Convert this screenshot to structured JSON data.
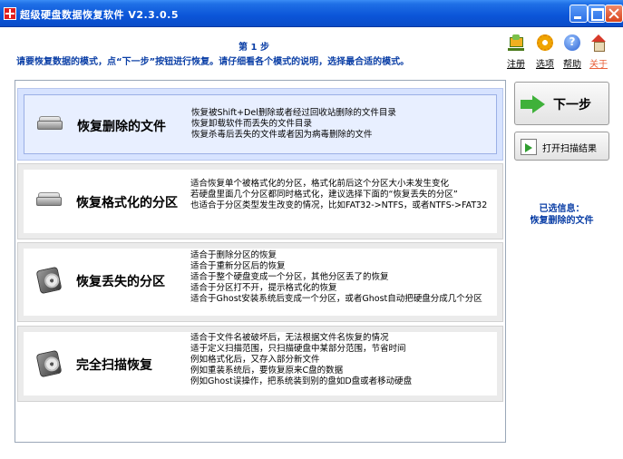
{
  "window": {
    "title": "超级硬盘数据恢复软件 V2.3.0.5"
  },
  "header": {
    "step": "第 1 步",
    "instruction": "请要恢复数据的模式，点“下一步”按钮进行恢复。请仔细看各个模式的说明，选择最合适的模式。"
  },
  "top_links": [
    {
      "label": "注册",
      "icon": "cart-icon"
    },
    {
      "label": "选项",
      "icon": "gear-icon"
    },
    {
      "label": "帮助",
      "icon": "help-icon"
    },
    {
      "label": "关于",
      "icon": "house-icon"
    }
  ],
  "modes": [
    {
      "name": "恢复删除的文件",
      "selected": true,
      "icon": "drive-icon",
      "description": [
        "恢复被Shift+Del删除或者经过回收站删除的文件目录",
        "恢复卸载软件而丢失的文件目录",
        "恢复杀毒后丢失的文件或者因为病毒删除的文件"
      ]
    },
    {
      "name": "恢复格式化的分区",
      "selected": false,
      "icon": "drive-icon",
      "description": [
        "适合恢复单个被格式化的分区，格式化前后这个分区大小未发生变化",
        "若硬盘里面几个分区都同时格式化，建议选择下面的“恢复丢失的分区”",
        "也适合于分区类型发生改变的情况，比如FAT32->NTFS，或者NTFS->FAT32"
      ]
    },
    {
      "name": "恢复丢失的分区",
      "selected": false,
      "icon": "hard-disk-icon",
      "description": [
        "适合于删除分区的恢复",
        "适合于重新分区后的恢复",
        "适合于整个硬盘变成一个分区，其他分区丢了的恢复",
        "适合于分区打不开，提示格式化的恢复",
        "适合于Ghost安装系统后变成一个分区，或者Ghost自动把硬盘分成几个分区"
      ]
    },
    {
      "name": "完全扫描恢复",
      "selected": false,
      "icon": "hard-disk-icon",
      "description": [
        "适合于文件名被破坏后，无法根据文件名恢复的情况",
        "适于定义扫描范围，只扫描硬盘中某部分范围，节省时间",
        "例如格式化后，又存入部分新文件",
        "例如重装系统后，要恢复原来C盘的数据",
        "例如Ghost误操作，把系统装到别的盘如D盘或者移动硬盘"
      ]
    }
  ],
  "buttons": {
    "next": "下一步",
    "open_scan": "打开扫描结果"
  },
  "selected_info": {
    "label": "已选信息：",
    "value": "恢复删除的文件"
  },
  "colors": {
    "titlebar": "#0b55d8",
    "header_text": "#0b3fa6",
    "selected_card": "#e8efff",
    "about_link": "#e8603a"
  }
}
